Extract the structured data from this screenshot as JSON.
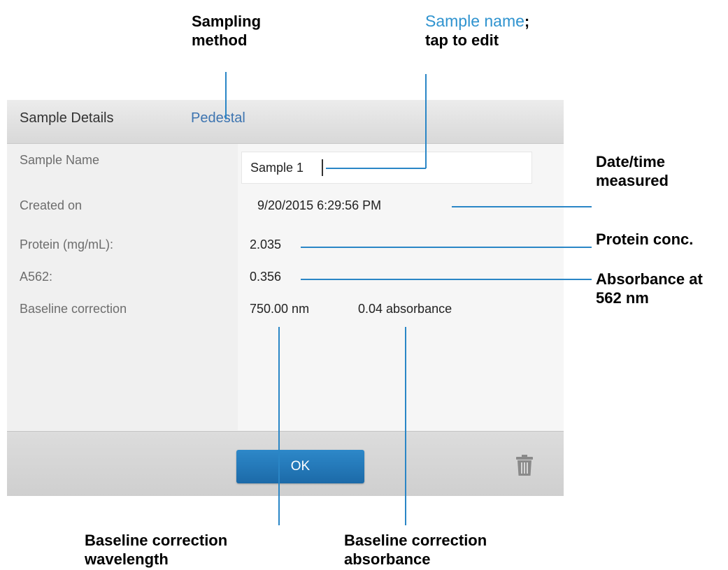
{
  "callouts": {
    "sampling_method": [
      "Sampling",
      "method"
    ],
    "sample_name": {
      "blue": "Sample name",
      "black": ";",
      "line2": "tap to edit"
    },
    "date_time": [
      "Date/time",
      "measured"
    ],
    "protein_conc": "Protein conc.",
    "absorbance": [
      "Absorbance at",
      "562 nm"
    ],
    "baseline_wavelength": [
      "Baseline correction",
      "wavelength"
    ],
    "baseline_absorbance": [
      "Baseline correction",
      "absorbance"
    ]
  },
  "dialog": {
    "title": "Sample Details",
    "method": "Pedestal",
    "rows": {
      "sample_name_label": "Sample Name",
      "sample_name_value": "Sample 1",
      "created_label": "Created on",
      "created_value": "9/20/2015 6:29:56 PM",
      "protein_label": "Protein (mg/mL):",
      "protein_value": "2.035",
      "a562_label": "A562:",
      "a562_value": "0.356",
      "baseline_label": "Baseline correction",
      "baseline_wavelength": "750.00 nm",
      "baseline_absorbance": "0.04 absorbance"
    },
    "ok_label": "OK",
    "trash_icon": "trash-icon"
  },
  "colors": {
    "accent_blue": "#2f93cf",
    "leader_line": "#2a86c6",
    "ok_button": "#2279b9"
  }
}
